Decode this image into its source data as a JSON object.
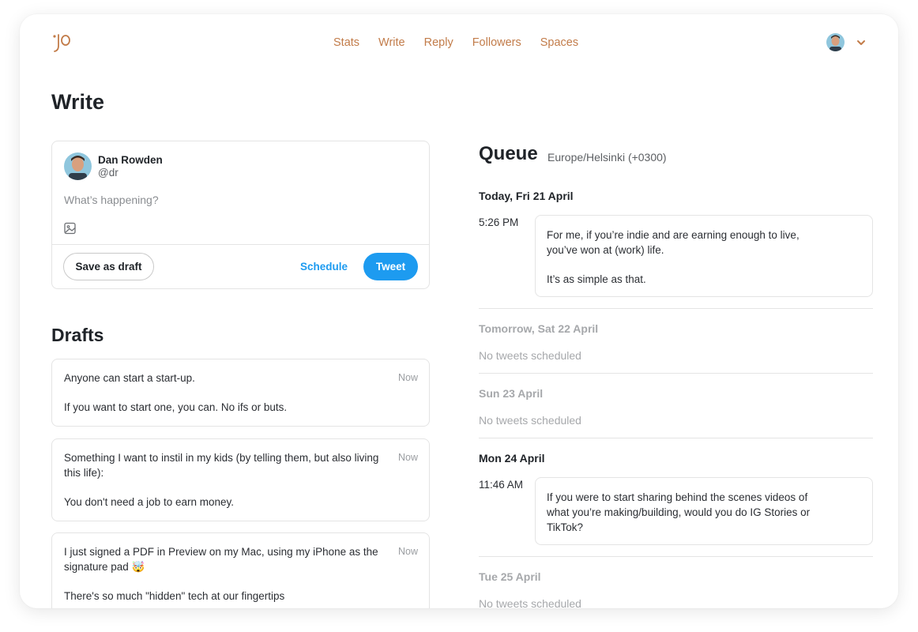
{
  "nav": {
    "items": [
      "Stats",
      "Write",
      "Reply",
      "Followers",
      "Spaces"
    ]
  },
  "page": {
    "title": "Write"
  },
  "composer": {
    "name": "Dan Rowden",
    "handle": "@dr",
    "placeholder": "What’s happening?",
    "save_label": "Save as draft",
    "schedule_label": "Schedule",
    "tweet_label": "Tweet"
  },
  "drafts": {
    "title": "Drafts",
    "items": [
      {
        "p1": "Anyone can start a start-up.",
        "p2": "If you want to start one, you can. No ifs or buts.",
        "time": "Now"
      },
      {
        "p1": "Something I want to instil in my kids (by telling them, but also living this life):",
        "p2": "You don't need a job to earn money.",
        "time": "Now"
      },
      {
        "p1": "I just signed a PDF in Preview on my Mac, using my iPhone as the signature pad 🤯",
        "p2": "There's so much \"hidden\" tech at our fingertips",
        "time": "Now"
      }
    ]
  },
  "queue": {
    "title": "Queue",
    "timezone": "Europe/Helsinki (+0300)",
    "days": [
      {
        "label": "Today, Fri 21 April",
        "time": "5:26 PM",
        "p1": "For me, if you’re indie and are earning enough to live, you’ve won at (work) life.",
        "p2": "It’s as simple as that."
      },
      {
        "label": "Tomorrow, Sat 22 April",
        "empty": "No tweets scheduled"
      },
      {
        "label": "Sun 23 April",
        "empty": "No tweets scheduled"
      },
      {
        "label": "Mon 24 April",
        "time": "11:46 AM",
        "p1": "If you were to start sharing behind the scenes videos of what you’re making/building, would you do IG Stories or TikTok?"
      },
      {
        "label": "Tue 25 April",
        "empty": "No tweets scheduled"
      }
    ]
  },
  "colors": {
    "accent": "#c27c4a",
    "primary": "#1d9bf0"
  },
  "icons": [
    "logo-icon",
    "avatar",
    "chevron-down-icon",
    "image-icon"
  ]
}
